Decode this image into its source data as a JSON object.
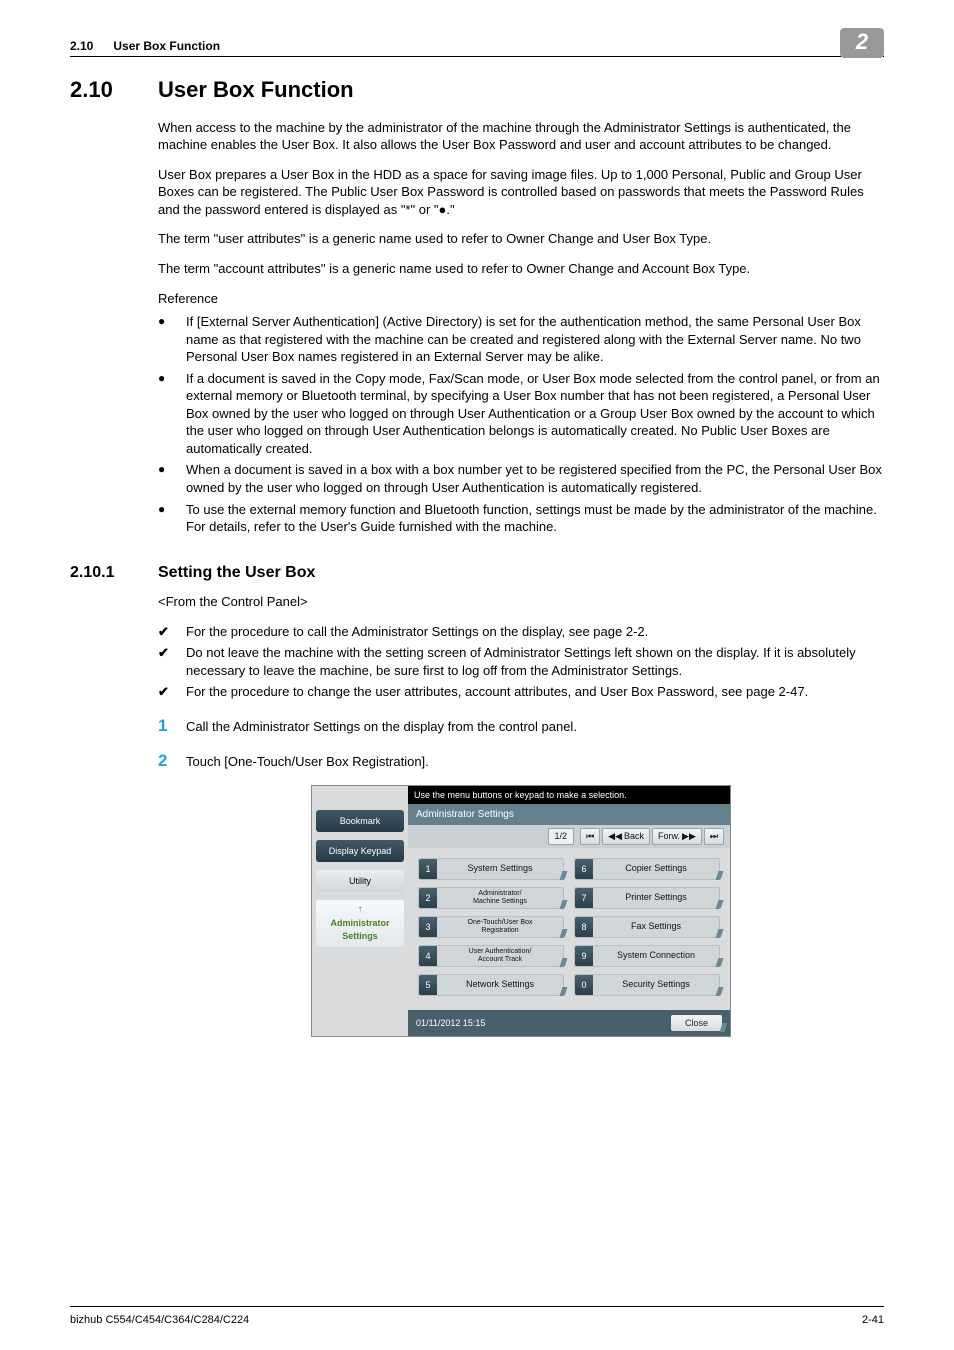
{
  "header": {
    "section_number": "2.10",
    "section_name": "User Box Function",
    "chapter_badge": "2"
  },
  "h1": {
    "num": "2.10",
    "title": "User Box Function"
  },
  "para1": "When access to the machine by the administrator of the machine through the Administrator Settings is authenticated, the machine enables the User Box. It also allows the User Box Password and user and account attributes to be changed.",
  "para2": "User Box prepares a User Box in the HDD as a space for saving image files. Up to 1,000 Personal, Public and Group User Boxes can be registered. The Public User Box Password is controlled based on passwords that meets the Password Rules and the password entered is displayed as \"*\" or \"●.\"",
  "para3": "The term \"user attributes\" is a generic name used to refer to Owner Change and User Box Type.",
  "para4": "The term \"account attributes\" is a generic name used to refer to Owner Change and Account Box Type.",
  "reference_label": "Reference",
  "bullets": [
    "If [External Server Authentication] (Active Directory) is set for the authentication method, the same Personal User Box name as that registered with the machine can be created and registered along with the External Server name. No two Personal User Box names registered in an External Server may be alike.",
    "If a document is saved in the Copy mode, Fax/Scan mode, or User Box mode selected from the control panel, or from an external memory or Bluetooth terminal, by specifying a User Box number that has not been registered, a Personal User Box owned by the user who logged on through User Authentication or a Group User Box owned by the account to which the user who logged on through User Authentication belongs is automatically created. No Public User Boxes are automatically created.",
    "When a document is saved in a box with a box number yet to be registered specified from the PC, the Personal User Box owned by the user who logged on through User Authentication is automatically registered.",
    "To use the external memory function and Bluetooth function, settings must be made by the administrator of the machine. For details, refer to the User's Guide furnished with the machine."
  ],
  "h2": {
    "num": "2.10.1",
    "title": "Setting the User Box"
  },
  "sub_caption": "<From the Control Panel>",
  "checks": [
    "For the procedure to call the Administrator Settings on the display, see page 2-2.",
    "Do not leave the machine with the setting screen of Administrator Settings left shown on the display. If it is absolutely necessary to leave the machine, be sure first to log off from the Administrator Settings.",
    "For the procedure to change the user attributes, account attributes, and User Box Password, see page 2-47."
  ],
  "steps": [
    "Call the Administrator Settings on the display from the control panel.",
    "Touch [One-Touch/User Box Registration]."
  ],
  "panel": {
    "instruction": "Use the menu buttons or keypad to make a selection.",
    "left_tabs": {
      "bookmark": "Bookmark",
      "keypad": "Display Keypad",
      "utility": "Utility",
      "admin": "Administrator Settings"
    },
    "subhead": "Administrator Settings",
    "toolbar": {
      "page": "1/2",
      "back": "Back",
      "forw": "Forw."
    },
    "options": [
      {
        "n": "1",
        "l": "System Settings"
      },
      {
        "n": "6",
        "l": "Copier Settings"
      },
      {
        "n": "2",
        "l": "Administrator/\nMachine Settings"
      },
      {
        "n": "7",
        "l": "Printer Settings"
      },
      {
        "n": "3",
        "l": "One-Touch/User Box\nRegistration"
      },
      {
        "n": "8",
        "l": "Fax Settings"
      },
      {
        "n": "4",
        "l": "User Authentication/\nAccount Track"
      },
      {
        "n": "9",
        "l": "System Connection"
      },
      {
        "n": "5",
        "l": "Network Settings"
      },
      {
        "n": "0",
        "l": "Security Settings"
      }
    ],
    "footer": {
      "datetime": "01/11/2012   15:15",
      "close": "Close"
    }
  },
  "footer": {
    "model": "bizhub C554/C454/C364/C284/C224",
    "page": "2-41"
  }
}
